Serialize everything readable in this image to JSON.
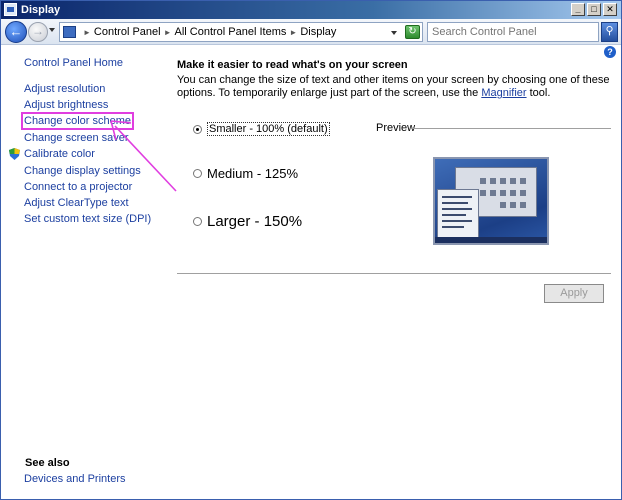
{
  "window": {
    "title": "Display"
  },
  "navbar": {
    "breadcrumbs": [
      "Control Panel",
      "All Control Panel Items",
      "Display"
    ],
    "search_placeholder": "Search Control Panel"
  },
  "sidebar": {
    "home": "Control Panel Home",
    "links": [
      "Adjust resolution",
      "Adjust brightness",
      "Change color scheme",
      "Change screen saver",
      "Calibrate color",
      "Change display settings",
      "Connect to a projector",
      "Adjust ClearType text",
      "Set custom text size (DPI)"
    ],
    "see_also_title": "See also",
    "see_also_links": [
      "Devices and Printers"
    ]
  },
  "main": {
    "heading": "Make it easier to read what's on your screen",
    "description_before": "You can change the size of text and other items on your screen by choosing one of these options. To temporarily enlarge just part of the screen, use the ",
    "description_link": "Magnifier",
    "description_after": " tool.",
    "options": [
      {
        "label": "Smaller - 100% (default)",
        "selected": true
      },
      {
        "label": "Medium - 125%",
        "selected": false
      },
      {
        "label": "Larger - 150%",
        "selected": false
      }
    ],
    "preview_label": "Preview",
    "apply_label": "Apply"
  },
  "colors": {
    "link": "#1c3fa0",
    "highlight": "#e03ee0",
    "annotation_arrow": "#e03ee0"
  }
}
